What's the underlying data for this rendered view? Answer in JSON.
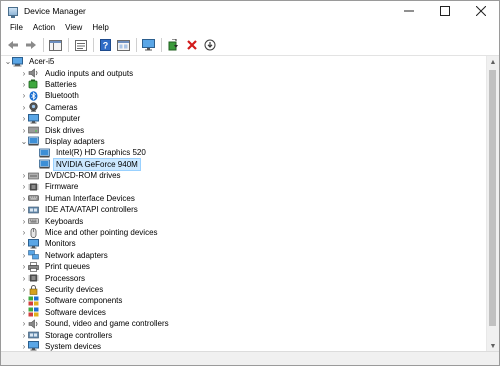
{
  "window": {
    "title": "Device Manager"
  },
  "menu": [
    "File",
    "Action",
    "View",
    "Help"
  ],
  "toolbar": {
    "buttons": [
      "back-icon",
      "forward-icon",
      "sep",
      "show-hide-tree-icon",
      "sep",
      "properties-icon",
      "sep",
      "help-icon",
      "view-icon",
      "sep",
      "monitor-icon",
      "sep",
      "update-driver-icon",
      "uninstall-icon",
      "download-icon"
    ]
  },
  "tree": {
    "root": {
      "label": "Acer-i5",
      "icon": "computer-icon"
    },
    "items": [
      {
        "label": "Audio inputs and outputs",
        "icon": "speaker-icon",
        "level": 1,
        "expanded": false
      },
      {
        "label": "Batteries",
        "icon": "battery-icon",
        "level": 1,
        "expanded": false
      },
      {
        "label": "Bluetooth",
        "icon": "bluetooth-icon",
        "level": 1,
        "expanded": false
      },
      {
        "label": "Cameras",
        "icon": "camera-icon",
        "level": 1,
        "expanded": false
      },
      {
        "label": "Computer",
        "icon": "monitor-icon",
        "level": 1,
        "expanded": false
      },
      {
        "label": "Disk drives",
        "icon": "disk-icon",
        "level": 1,
        "expanded": false
      },
      {
        "label": "Display adapters",
        "icon": "display-adapter-icon",
        "level": 1,
        "expanded": true
      },
      {
        "label": "Intel(R) HD Graphics 520",
        "icon": "display-adapter-icon",
        "level": 2
      },
      {
        "label": "NVIDIA GeForce 940M",
        "icon": "display-adapter-icon",
        "level": 2,
        "selected": true
      },
      {
        "label": "DVD/CD-ROM drives",
        "icon": "dvd-icon",
        "level": 1,
        "expanded": false
      },
      {
        "label": "Firmware",
        "icon": "chip-icon",
        "level": 1,
        "expanded": false
      },
      {
        "label": "Human Interface Devices",
        "icon": "hid-icon",
        "level": 1,
        "expanded": false
      },
      {
        "label": "IDE ATA/ATAPI controllers",
        "icon": "controller-icon",
        "level": 1,
        "expanded": false
      },
      {
        "label": "Keyboards",
        "icon": "keyboard-icon",
        "level": 1,
        "expanded": false
      },
      {
        "label": "Mice and other pointing devices",
        "icon": "mouse-icon",
        "level": 1,
        "expanded": false
      },
      {
        "label": "Monitors",
        "icon": "monitor-icon",
        "level": 1,
        "expanded": false
      },
      {
        "label": "Network adapters",
        "icon": "network-icon",
        "level": 1,
        "expanded": false
      },
      {
        "label": "Print queues",
        "icon": "printer-icon",
        "level": 1,
        "expanded": false
      },
      {
        "label": "Processors",
        "icon": "chip-icon",
        "level": 1,
        "expanded": false
      },
      {
        "label": "Security devices",
        "icon": "security-icon",
        "level": 1,
        "expanded": false
      },
      {
        "label": "Software components",
        "icon": "software-icon",
        "level": 1,
        "expanded": false
      },
      {
        "label": "Software devices",
        "icon": "software-icon",
        "level": 1,
        "expanded": false
      },
      {
        "label": "Sound, video and game controllers",
        "icon": "speaker-icon",
        "level": 1,
        "expanded": false
      },
      {
        "label": "Storage controllers",
        "icon": "controller-icon",
        "level": 1,
        "expanded": false
      },
      {
        "label": "System devices",
        "icon": "monitor-icon",
        "level": 1,
        "expanded": false
      }
    ]
  },
  "colors": {
    "selection": "#cce8ff",
    "accent": "#1e7ad4"
  }
}
